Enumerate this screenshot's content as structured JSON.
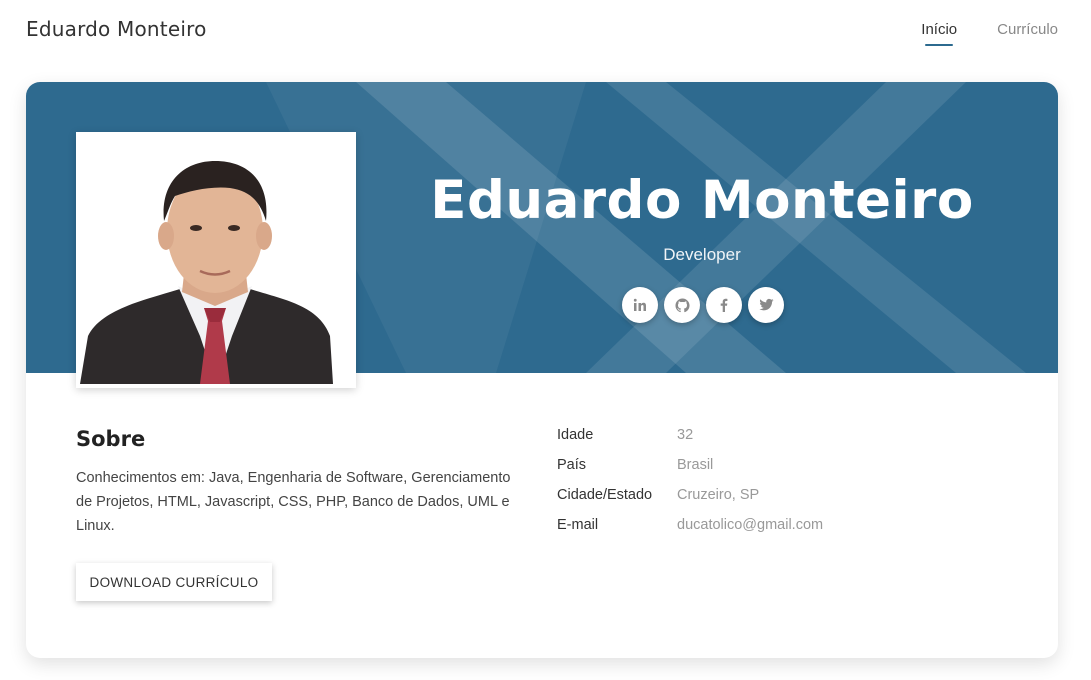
{
  "header": {
    "brand": "Eduardo Monteiro",
    "nav": [
      {
        "label": "Início",
        "active": true
      },
      {
        "label": "Currículo",
        "active": false
      }
    ]
  },
  "hero": {
    "name": "Eduardo Monteiro",
    "role": "Developer",
    "socials": [
      "linkedin-icon",
      "github-icon",
      "facebook-icon",
      "twitter-icon"
    ],
    "banner_color": "#2e6a8f"
  },
  "about": {
    "title": "Sobre",
    "text": "Conhecimentos em: Java, Engenharia de Software, Gerenciamento de Projetos, HTML, Javascript, CSS, PHP, Banco de Dados, UML e Linux.",
    "button_label": "DOWNLOAD CURRÍCULO"
  },
  "info": [
    {
      "label": "Idade",
      "value": "32"
    },
    {
      "label": "País",
      "value": "Brasil"
    },
    {
      "label": "Cidade/Estado",
      "value": "Cruzeiro, SP"
    },
    {
      "label": "E-mail",
      "value": "ducatolico@gmail.com"
    }
  ],
  "colors": {
    "accent": "#2c6a8f",
    "icon": "#8a8a8a"
  }
}
